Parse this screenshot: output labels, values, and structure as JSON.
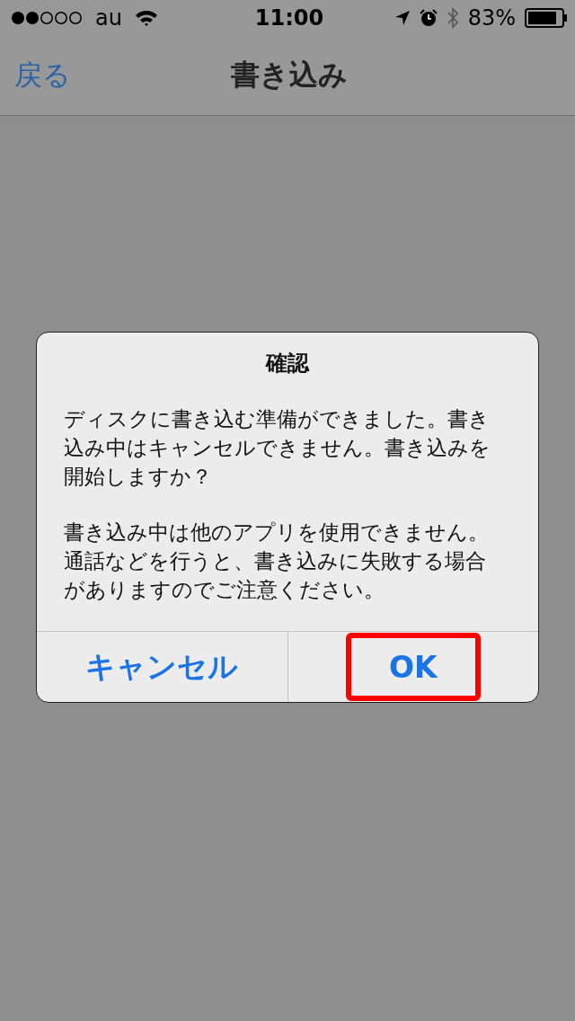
{
  "status_bar": {
    "carrier": "au",
    "time": "11:00",
    "battery": "83%"
  },
  "nav_bar": {
    "back": "戻る",
    "title": "書き込み"
  },
  "dialog": {
    "title": "確認",
    "paragraphs": [
      "ディスクに書き込む準備ができました。書き込み中はキャンセルできません。書き込みを開始しますか？",
      "書き込み中は他のアプリを使用できません。通話などを行うと、書き込みに失敗する場合がありますのでご注意ください。"
    ],
    "buttons": [
      {
        "label": "キャンセル",
        "highlighted": false
      },
      {
        "label": "OK",
        "highlighted": true
      }
    ]
  }
}
